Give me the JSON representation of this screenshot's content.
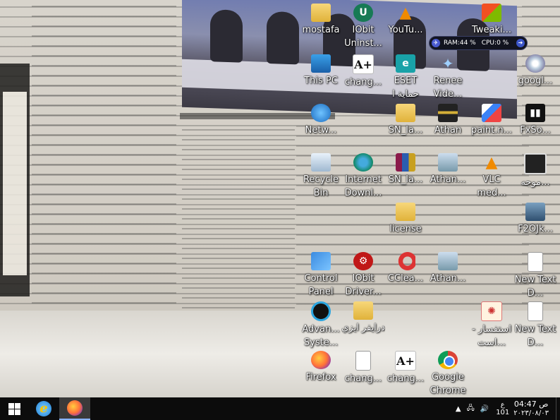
{
  "desktop": {
    "icons": [
      {
        "id": "mostafa",
        "label": "mostafa",
        "icon": "folder-icon"
      },
      {
        "id": "iobit-uninstaller",
        "label": "IObit Uninst...",
        "icon": "iobit-uninstaller-icon"
      },
      {
        "id": "youtube",
        "label": "YouTu...",
        "icon": "vlc-icon"
      },
      {
        "id": "tweaking",
        "label": "Tweaki...",
        "icon": "windows-repair-icon"
      },
      {
        "id": "this-pc",
        "label": "This PC",
        "icon": "computer-icon"
      },
      {
        "id": "chang1",
        "label": "chang...",
        "icon": "a-plus-icon"
      },
      {
        "id": "eset",
        "label": "ESET حماية ا",
        "icon": "eset-icon"
      },
      {
        "id": "renee",
        "label": "Renee Vide...",
        "icon": "renee-icon"
      },
      {
        "id": "google",
        "label": "googl...",
        "icon": "cd-icon"
      },
      {
        "id": "network",
        "label": "Netw...",
        "icon": "network-icon"
      },
      {
        "id": "sn-la-1",
        "label": "SN_la...",
        "icon": "folder-icon"
      },
      {
        "id": "athan-1",
        "label": "Athan",
        "icon": "athan-icon"
      },
      {
        "id": "paint",
        "label": "paint.n...",
        "icon": "paint-icon"
      },
      {
        "id": "fxsound",
        "label": "FxSo...",
        "icon": "fxsound-icon"
      },
      {
        "id": "recycle-bin",
        "label": "Recycle Bin",
        "icon": "recycle-bin-icon"
      },
      {
        "id": "idm",
        "label": "Internet Downl...",
        "icon": "idm-icon"
      },
      {
        "id": "sn-la-2",
        "label": "SN_la...",
        "icon": "winrar-icon"
      },
      {
        "id": "athan-2",
        "label": "Athan...",
        "icon": "setup-icon"
      },
      {
        "id": "vlc",
        "label": "VLC med...",
        "icon": "vlc-icon"
      },
      {
        "id": "mostajah",
        "label": "موجه...",
        "icon": "cmd-icon"
      },
      {
        "id": "license",
        "label": "license",
        "icon": "folder-icon"
      },
      {
        "id": "f2ojk",
        "label": "F2OJk...",
        "icon": "film-icon"
      },
      {
        "id": "control-panel",
        "label": "Control Panel",
        "icon": "control-panel-icon"
      },
      {
        "id": "iobit-driver",
        "label": "IObit Driver...",
        "icon": "driver-booster-icon"
      },
      {
        "id": "ccleaner",
        "label": "CClea...",
        "icon": "ccleaner-icon"
      },
      {
        "id": "athan-3",
        "label": "Athan...",
        "icon": "setup-icon"
      },
      {
        "id": "new-text-1",
        "label": "New Text D...",
        "icon": "text-file-icon"
      },
      {
        "id": "advanced-systemcare",
        "label": "Advan... Syste...",
        "icon": "advanced-systemcare-icon"
      },
      {
        "id": "driver-easy",
        "label": "درايفر ايزي",
        "icon": "folder-icon"
      },
      {
        "id": "estfsar",
        "label": "استفسار - است...",
        "icon": "inquiry-icon"
      },
      {
        "id": "new-text-2",
        "label": "New Text D...",
        "icon": "text-file-icon"
      },
      {
        "id": "firefox",
        "label": "Firefox",
        "icon": "firefox-icon"
      },
      {
        "id": "chang2",
        "label": "chang...",
        "icon": "text-file-icon"
      },
      {
        "id": "chang3",
        "label": "chang...",
        "icon": "a-plus-icon"
      },
      {
        "id": "chrome",
        "label": "Google Chrome",
        "icon": "chrome-icon"
      }
    ]
  },
  "sysmon": {
    "ram_label": "RAM:",
    "ram_value": "44 %",
    "cpu_label": "CPU:",
    "cpu_value": "0 %"
  },
  "taskbar": {
    "start_label": "Start",
    "tray": {
      "lang_top": "ع",
      "lang_bottom": "101",
      "time": "04:47 ص",
      "date": "٢٠٢٣/٠٨/٠٣"
    }
  }
}
